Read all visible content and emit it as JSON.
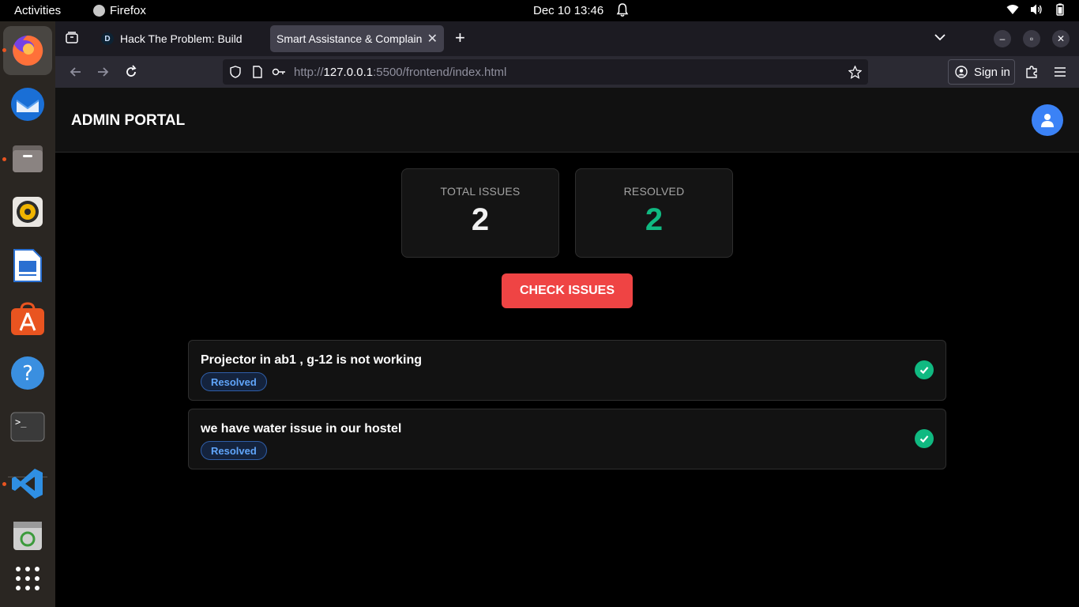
{
  "topbar": {
    "activities": "Activities",
    "app_name": "Firefox",
    "clock": "Dec 10  13:46"
  },
  "browser": {
    "tabs": [
      {
        "label": "Hack The Problem: Build",
        "favicon": "D"
      },
      {
        "label": "Smart Assistance & Complain"
      }
    ],
    "url_prefix": "http://",
    "url_host": "127.0.0.1",
    "url_rest": ":5500/frontend/index.html",
    "sign_in": "Sign in"
  },
  "page": {
    "brand": "ADMIN PORTAL",
    "stats": {
      "total_label": "TOTAL ISSUES",
      "total_value": "2",
      "resolved_label": "RESOLVED",
      "resolved_value": "2"
    },
    "check_button": "CHECK ISSUES",
    "issues": [
      {
        "text": "Projector in ab1 , g-12 is not working",
        "status": "Resolved"
      },
      {
        "text": "we have water issue in our hostel",
        "status": "Resolved"
      }
    ]
  },
  "colors": {
    "accent_red": "#ef4444",
    "resolved_green": "#10b981",
    "avatar_blue": "#3b82f6"
  },
  "icons": [
    "firefox-icon",
    "bell-icon",
    "wifi-icon",
    "volume-icon",
    "battery-icon",
    "user-icon",
    "check-icon"
  ]
}
